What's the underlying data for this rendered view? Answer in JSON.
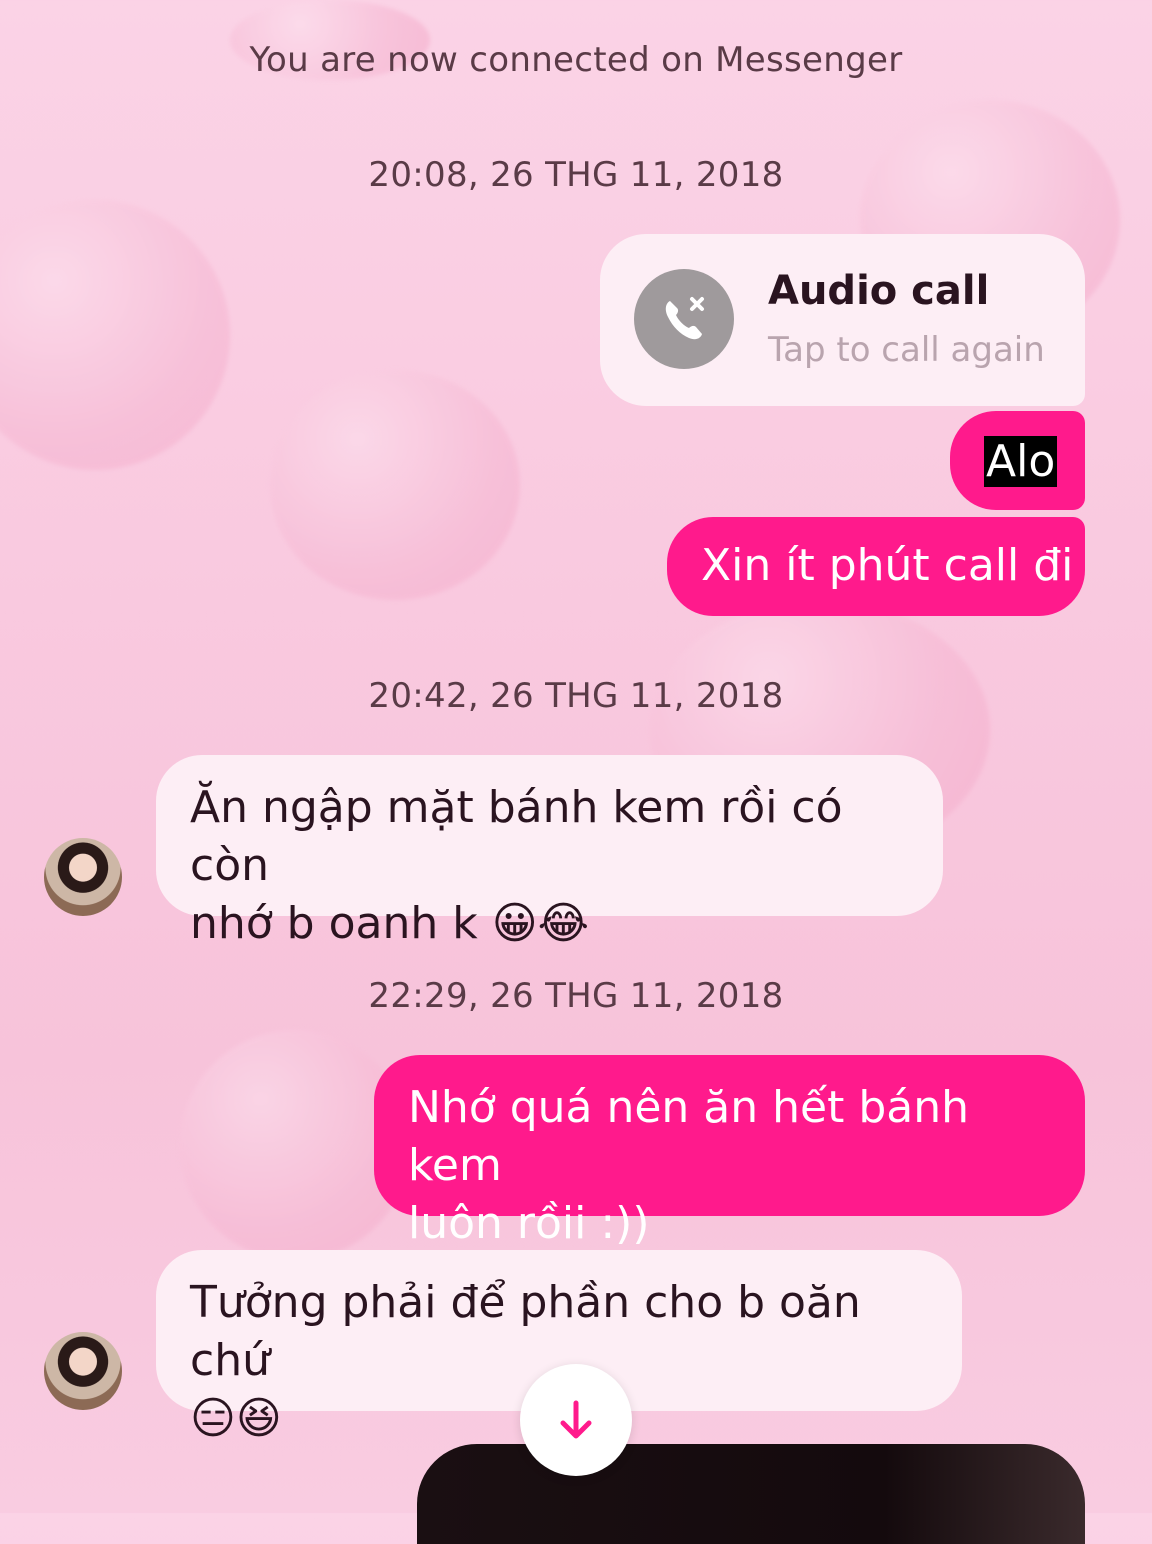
{
  "system_message": "You are now connected on Messenger",
  "timestamps": [
    "20:08, 26 THG 11, 2018",
    "20:42, 26 THG 11, 2018",
    "22:29, 26 THG 11, 2018"
  ],
  "call_card": {
    "title": "Audio call",
    "subtitle": "Tap to call again",
    "icon": "missed-call-icon"
  },
  "messages": [
    {
      "from": "me",
      "text": "Alo"
    },
    {
      "from": "me",
      "text": "Xin ít phút call đi"
    },
    {
      "from": "them",
      "text": "Ăn ngập mặt bánh kem rồi có còn",
      "text2": "nhớ b oanh k 😀😂"
    },
    {
      "from": "me",
      "text": "Nhớ quá nên ăn hết bánh kem",
      "text2": "luôn rồii :))"
    },
    {
      "from": "them",
      "text": "Tưởng phải để phần cho b oăn chứ",
      "text2": "😑😆"
    }
  ],
  "scroll_button": {
    "icon": "arrow-down-icon"
  },
  "colors": {
    "outgoing": "#ff1a8c",
    "incoming": "#fdeef5",
    "accent": "#ff1a8c"
  }
}
